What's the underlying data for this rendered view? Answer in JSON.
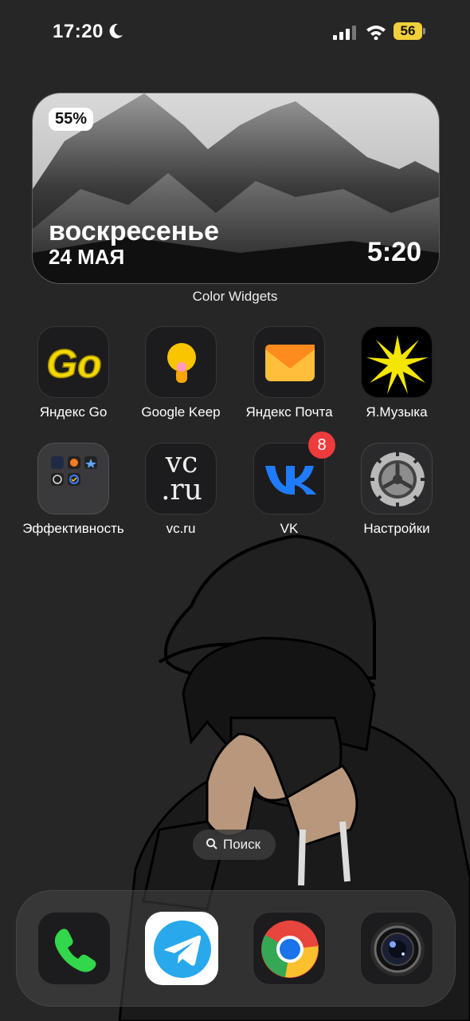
{
  "status_bar": {
    "time": "17:20",
    "battery_level": "56",
    "icons": [
      "moon-icon",
      "cellular-signal-icon",
      "wifi-icon",
      "battery-icon"
    ]
  },
  "widget": {
    "battery_percent": "55%",
    "weekday": "воскресенье",
    "date": "24 МАЯ",
    "clock": "5:20",
    "caption": "Color Widgets"
  },
  "apps": [
    {
      "label": "Яндекс Go",
      "icon": "yandex-go-icon"
    },
    {
      "label": "Google Keep",
      "icon": "google-keep-icon"
    },
    {
      "label": "Яндекс Почта",
      "icon": "yandex-mail-icon"
    },
    {
      "label": "Я.Музыка",
      "icon": "yandex-music-icon"
    },
    {
      "label": "Эффективность",
      "icon": "folder-icon"
    },
    {
      "label": "vc.ru",
      "icon": "vcru-icon",
      "icon_text_1": "vc",
      "icon_text_2": ".ru"
    },
    {
      "label": "VK",
      "icon": "vk-icon",
      "badge": "8"
    },
    {
      "label": "Настройки",
      "icon": "settings-gear-icon"
    }
  ],
  "app_icon_texts": {
    "yandex_go": "Go"
  },
  "search": {
    "label": "Поиск"
  },
  "dock": [
    "phone-icon",
    "telegram-icon",
    "chrome-icon",
    "camera-icon"
  ],
  "colors": {
    "accent_yellow": "#f2d03b",
    "badge_red": "#ee3b3b",
    "vk_blue": "#0077ff"
  }
}
